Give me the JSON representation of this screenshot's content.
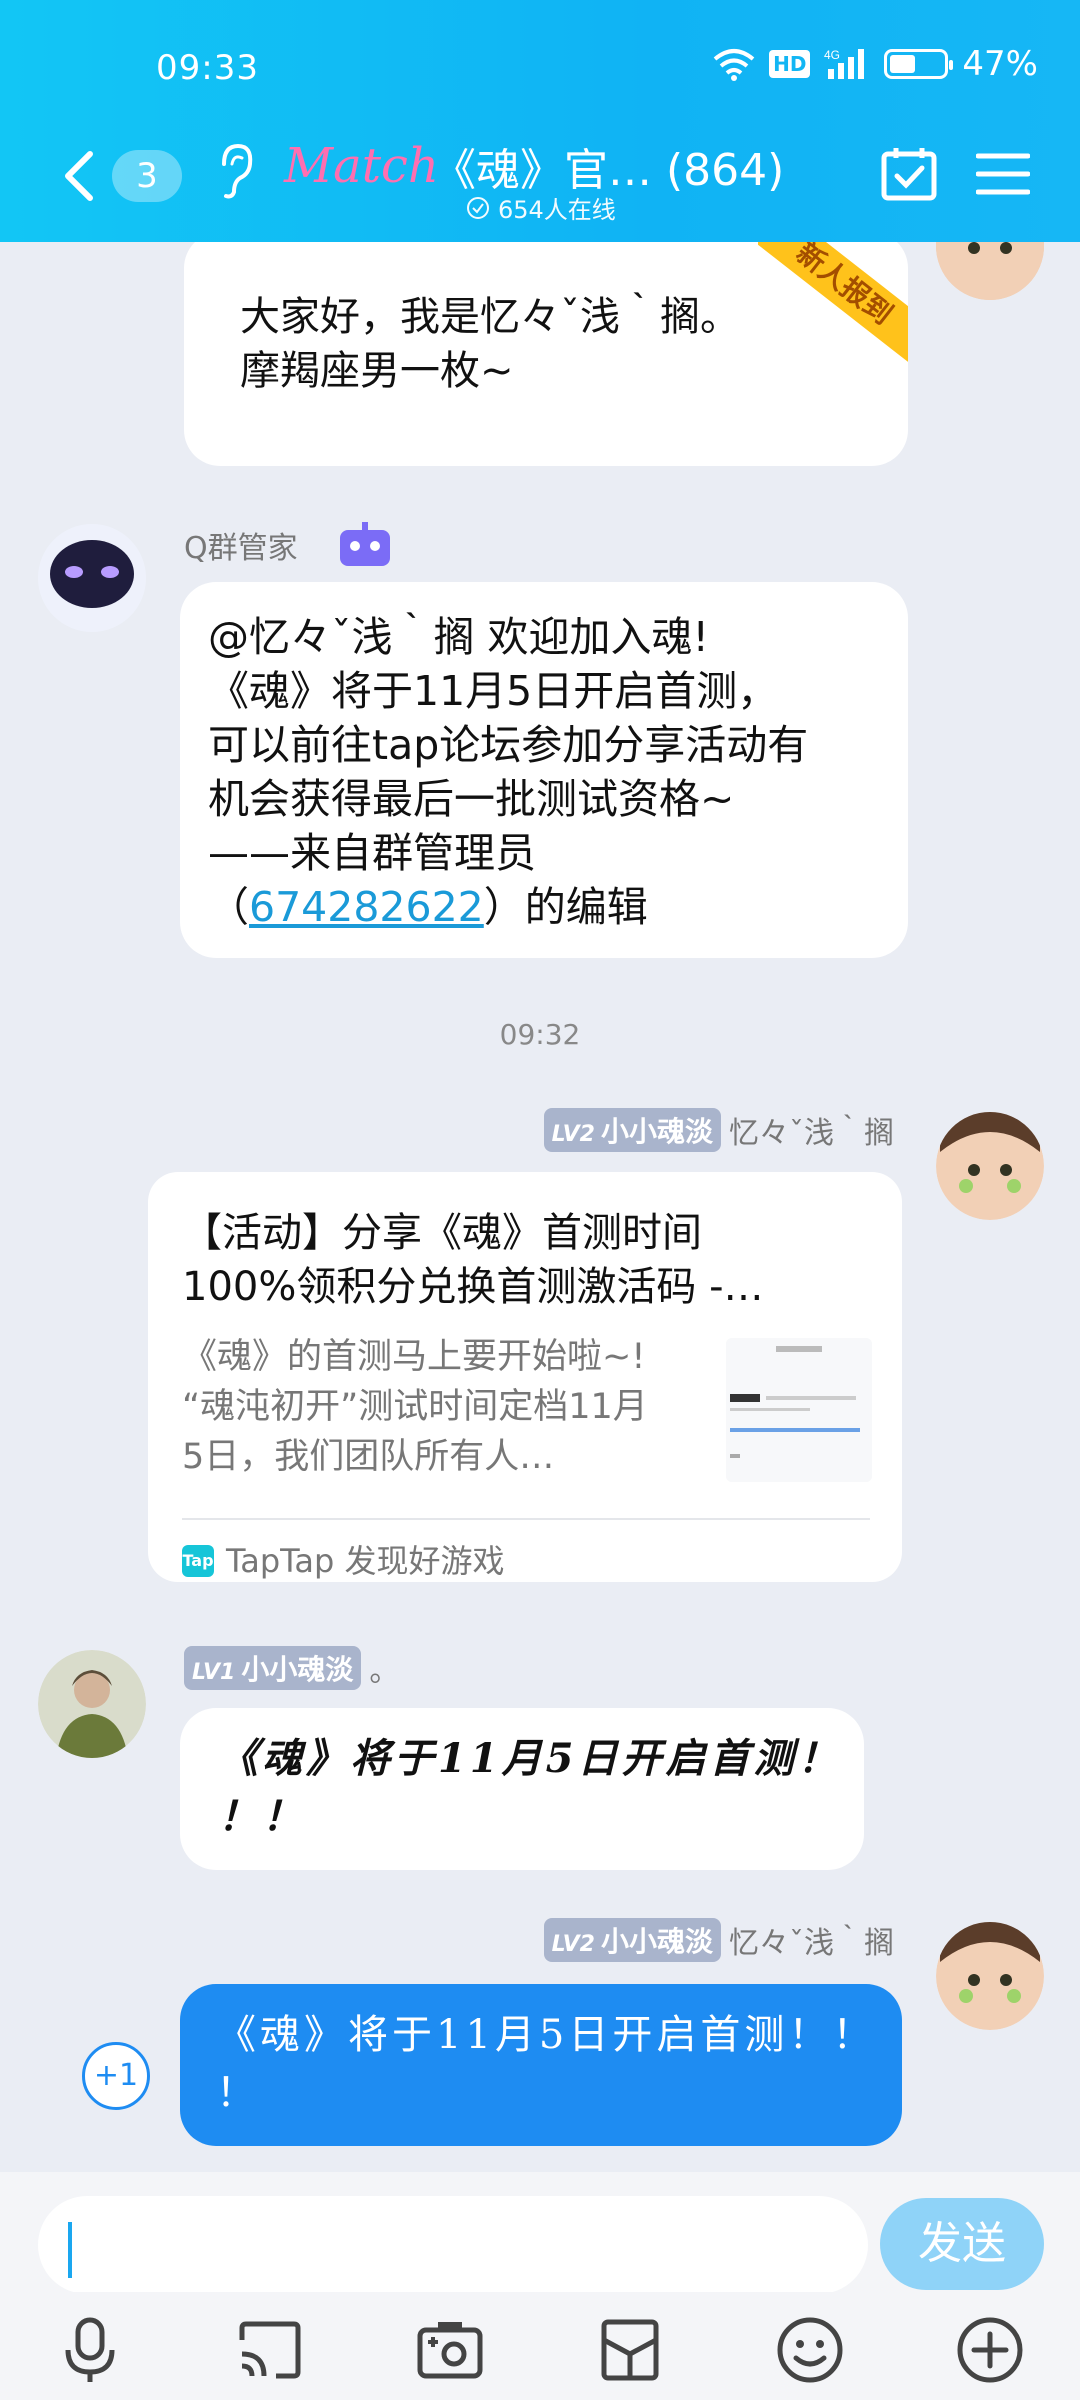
{
  "status_bar": {
    "time": "09:33",
    "battery": "47%",
    "hd": "HD",
    "net": "4G"
  },
  "header": {
    "unread_count": "3",
    "match_logo": "Match",
    "title": "《魂》官… (864)",
    "online": "654人在线"
  },
  "messages": {
    "intro": {
      "text_line1": "大家好，我是忆々ˇ浅｀搁。",
      "text_line2": "摩羯座男一枚~",
      "badge": "新人报到"
    },
    "bot": {
      "sender": "Q群管家",
      "line1": "@忆々ˇ浅｀搁 欢迎加入魂!",
      "line2": "《魂》将于11月5日开启首测，",
      "line3": "可以前往tap论坛参加分享活动有",
      "line4": "机会获得最后一批测试资格~",
      "line5": "——来自群管理员",
      "line6_prefix": "（",
      "line6_link": "674282622",
      "line6_suffix": "）的编辑"
    },
    "timestamp": "09:32",
    "share": {
      "level": "LV2",
      "title": "小小魂淡",
      "sender": "忆々ˇ浅｀搁",
      "card_title_1": "【活动】分享《魂》首测时间",
      "card_title_2": "100%领积分兑换首测激活码 -…",
      "card_desc_1": "《魂》的首测马上要开始啦~!",
      "card_desc_2": "“魂沌初开”测试时间定档11月",
      "card_desc_3": "5日，我们团队所有人…",
      "source": "TapTap 发现好游戏",
      "tap_logo": "Tap"
    },
    "other": {
      "level": "LV1",
      "title": "小小魂淡",
      "name_suffix": "。",
      "line1": "《魂》将于11月5日开启首测！",
      "line2": "！！"
    },
    "mine": {
      "level": "LV2",
      "title": "小小魂淡",
      "sender": "忆々ˇ浅｀搁",
      "line1": "《魂》将于11月5日开启首测！！",
      "line2": "！",
      "plus_one": "+1"
    }
  },
  "input": {
    "placeholder": "",
    "send_label": "发送"
  },
  "colors": {
    "header": "#12c6f5",
    "bubble_mine": "#1e8cf2",
    "link": "#1a9ad8",
    "badge": "#ffc21b"
  },
  "icons": [
    "back-arrow-icon",
    "ear-icon",
    "calendar-check-icon",
    "menu-icon",
    "microphone-icon",
    "cast-icon",
    "camera-icon",
    "gift-box-icon",
    "emoji-icon",
    "plus-circle-icon"
  ]
}
